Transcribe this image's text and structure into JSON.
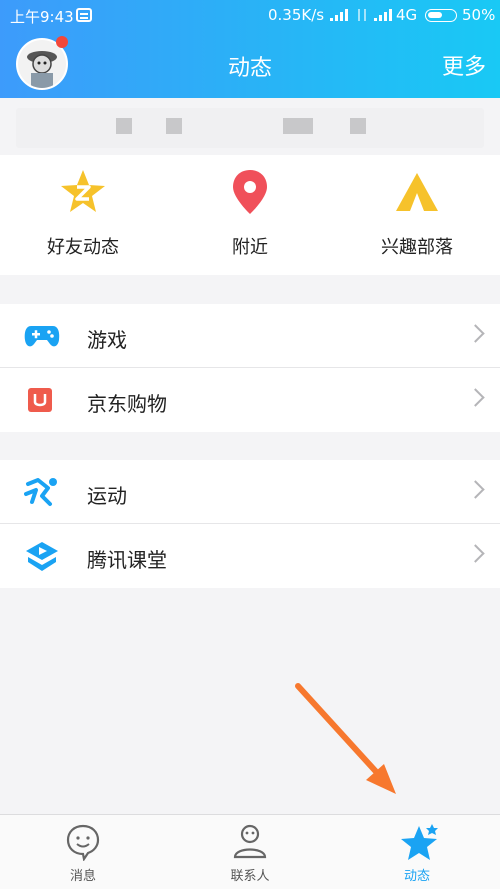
{
  "status_bar": {
    "time": "上午9:43",
    "speed": "0.35K/s",
    "network": "4G",
    "battery": "50%"
  },
  "header": {
    "title": "动态",
    "more_label": "更多"
  },
  "quick_actions": [
    {
      "label": "好友动态",
      "icon": "qzone-star-icon",
      "color": "#f6c22b"
    },
    {
      "label": "附近",
      "icon": "location-pin-icon",
      "color": "#f0505a"
    },
    {
      "label": "兴趣部落",
      "icon": "tent-icon",
      "color": "#f6c22b"
    }
  ],
  "menu_groups": [
    [
      {
        "label": "游戏",
        "icon": "gamepad-icon",
        "color": "#1aa3f3"
      },
      {
        "label": "京东购物",
        "icon": "jd-shopping-icon",
        "color": "#ef5b4c"
      }
    ],
    [
      {
        "label": "运动",
        "icon": "runner-icon",
        "color": "#1aa3f3"
      },
      {
        "label": "腾讯课堂",
        "icon": "tencent-classroom-icon",
        "color": "#1aa3f3"
      }
    ]
  ],
  "tab_bar": {
    "tabs": [
      {
        "label": "消息",
        "icon": "chat-smile-icon"
      },
      {
        "label": "联系人",
        "icon": "contacts-person-icon"
      },
      {
        "label": "动态",
        "icon": "dynamic-star-icon",
        "active": true
      }
    ]
  },
  "colors": {
    "accent": "#1aa3f3",
    "header_gradient_start": "#3d9bfb",
    "header_gradient_end": "#19c9f5",
    "annotation_arrow": "#f7782e"
  }
}
